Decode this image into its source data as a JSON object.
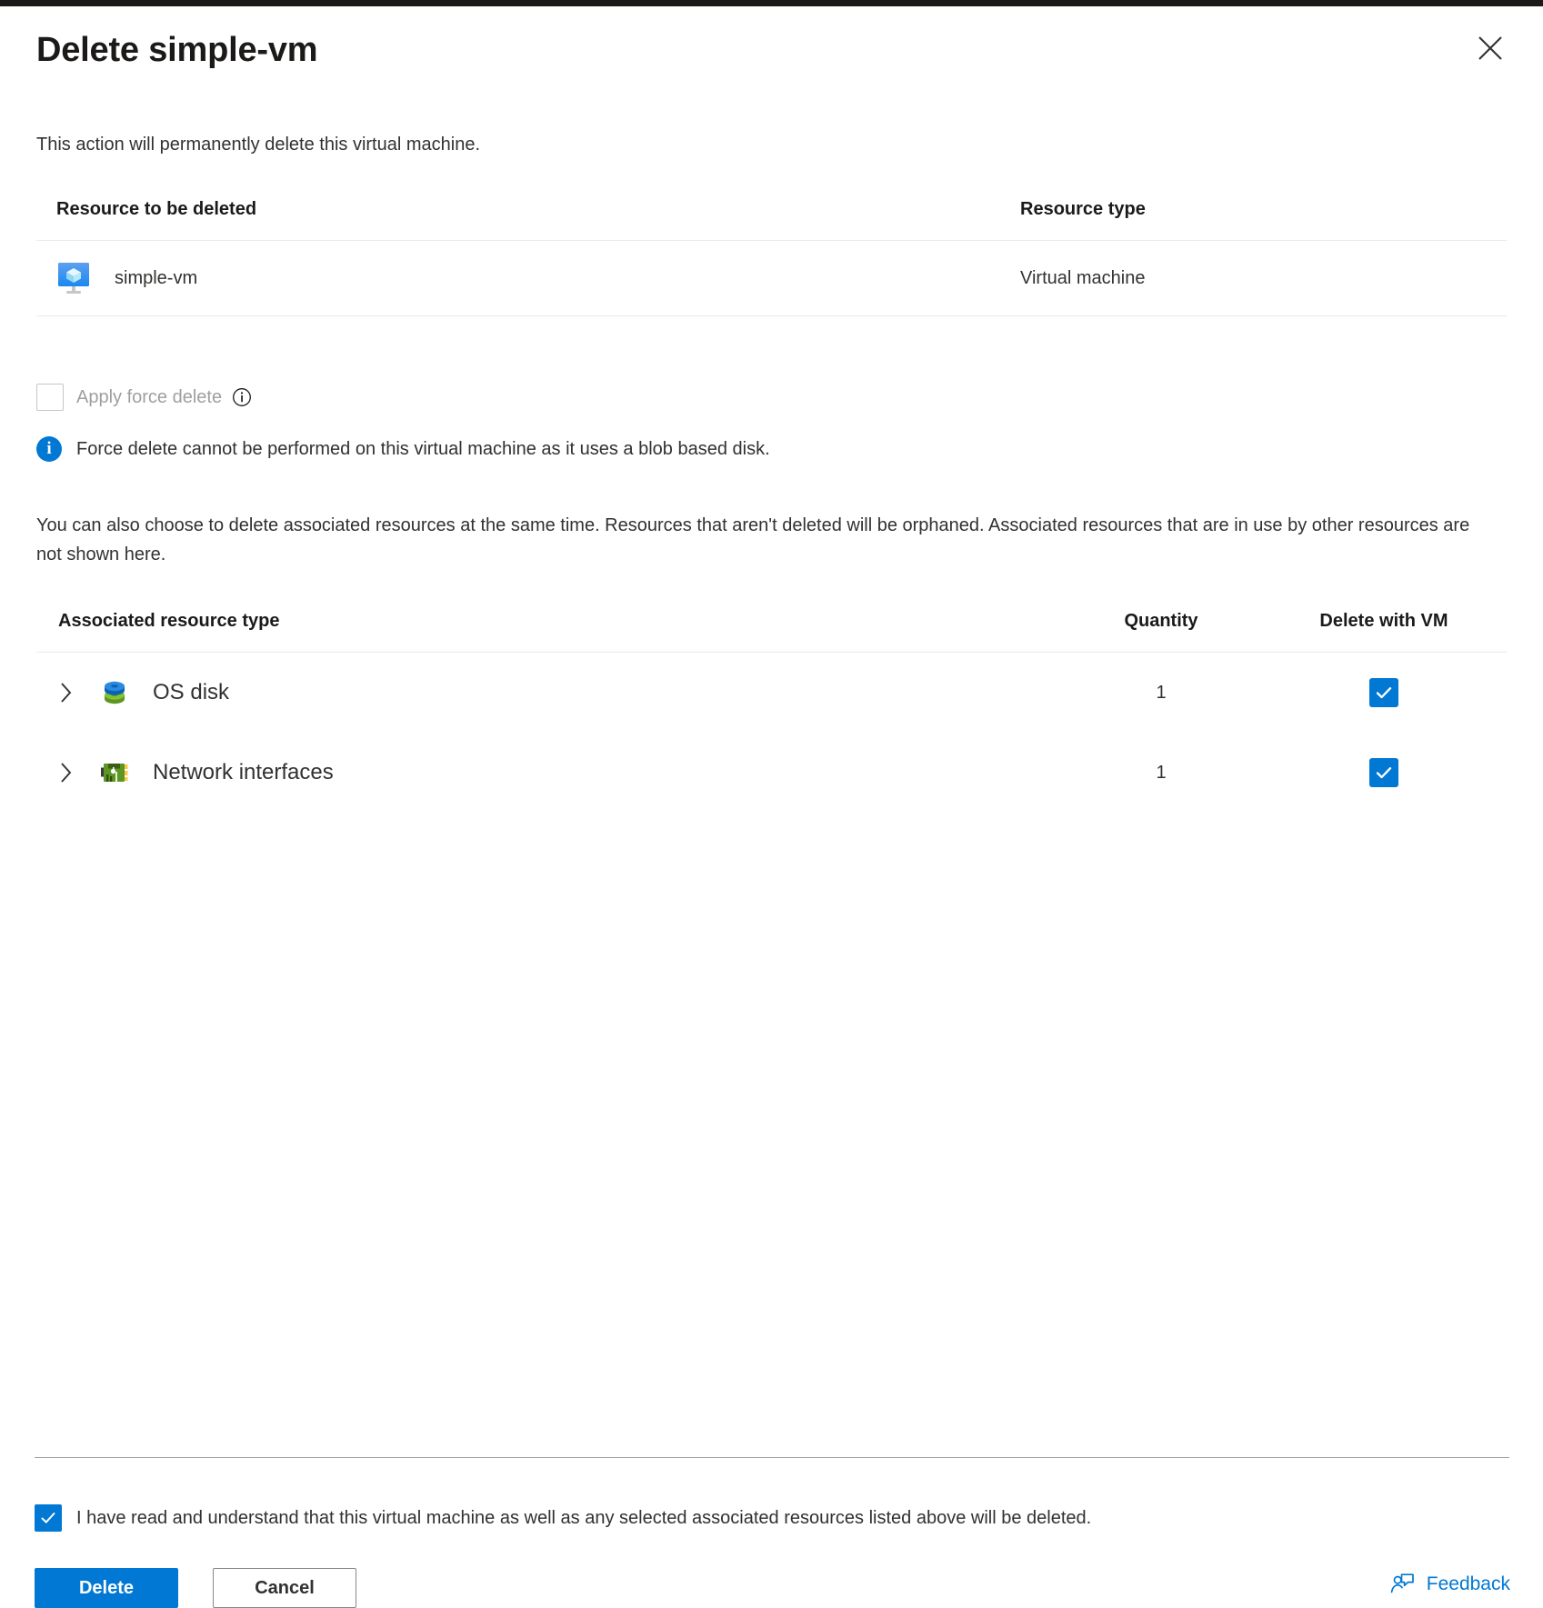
{
  "dialog": {
    "title": "Delete simple-vm",
    "close_label": "Close",
    "lead_text": "This action will permanently delete this virtual machine."
  },
  "resource_table": {
    "columns": [
      "Resource to be deleted",
      "Resource type"
    ],
    "rows": [
      {
        "icon": "virtual-machine-icon",
        "name": "simple-vm",
        "type": "Virtual machine"
      }
    ]
  },
  "force_delete": {
    "label": "Apply force delete",
    "checked": false,
    "disabled": true,
    "info_icon": "info-outline-icon",
    "message": "Force delete cannot be performed on this virtual machine as it uses a blob based disk.",
    "message_icon": "info-filled-icon"
  },
  "associated": {
    "description": "You can also choose to delete associated resources at the same time. Resources that aren't deleted will be orphaned. Associated resources that are in use by other resources are not shown here.",
    "columns": {
      "type": "Associated resource type",
      "quantity": "Quantity",
      "delete_with_vm": "Delete with VM"
    },
    "rows": [
      {
        "expand_icon": "chevron-right-icon",
        "icon": "os-disk-icon",
        "label": "OS disk",
        "quantity": "1",
        "checked": true
      },
      {
        "expand_icon": "chevron-right-icon",
        "icon": "network-interface-icon",
        "label": "Network interfaces",
        "quantity": "1",
        "checked": true
      }
    ]
  },
  "footer": {
    "acknowledgement": "I have read and understand that this virtual machine as well as any selected associated resources listed above will be deleted.",
    "acknowledged": true,
    "delete_label": "Delete",
    "cancel_label": "Cancel",
    "feedback_label": "Feedback",
    "feedback_icon": "person-feedback-icon"
  },
  "colors": {
    "accent": "#0078d4",
    "text": "#323130",
    "disabled_text": "#a19f9d",
    "border": "#edebe9",
    "topbar": "#1b1a19"
  }
}
